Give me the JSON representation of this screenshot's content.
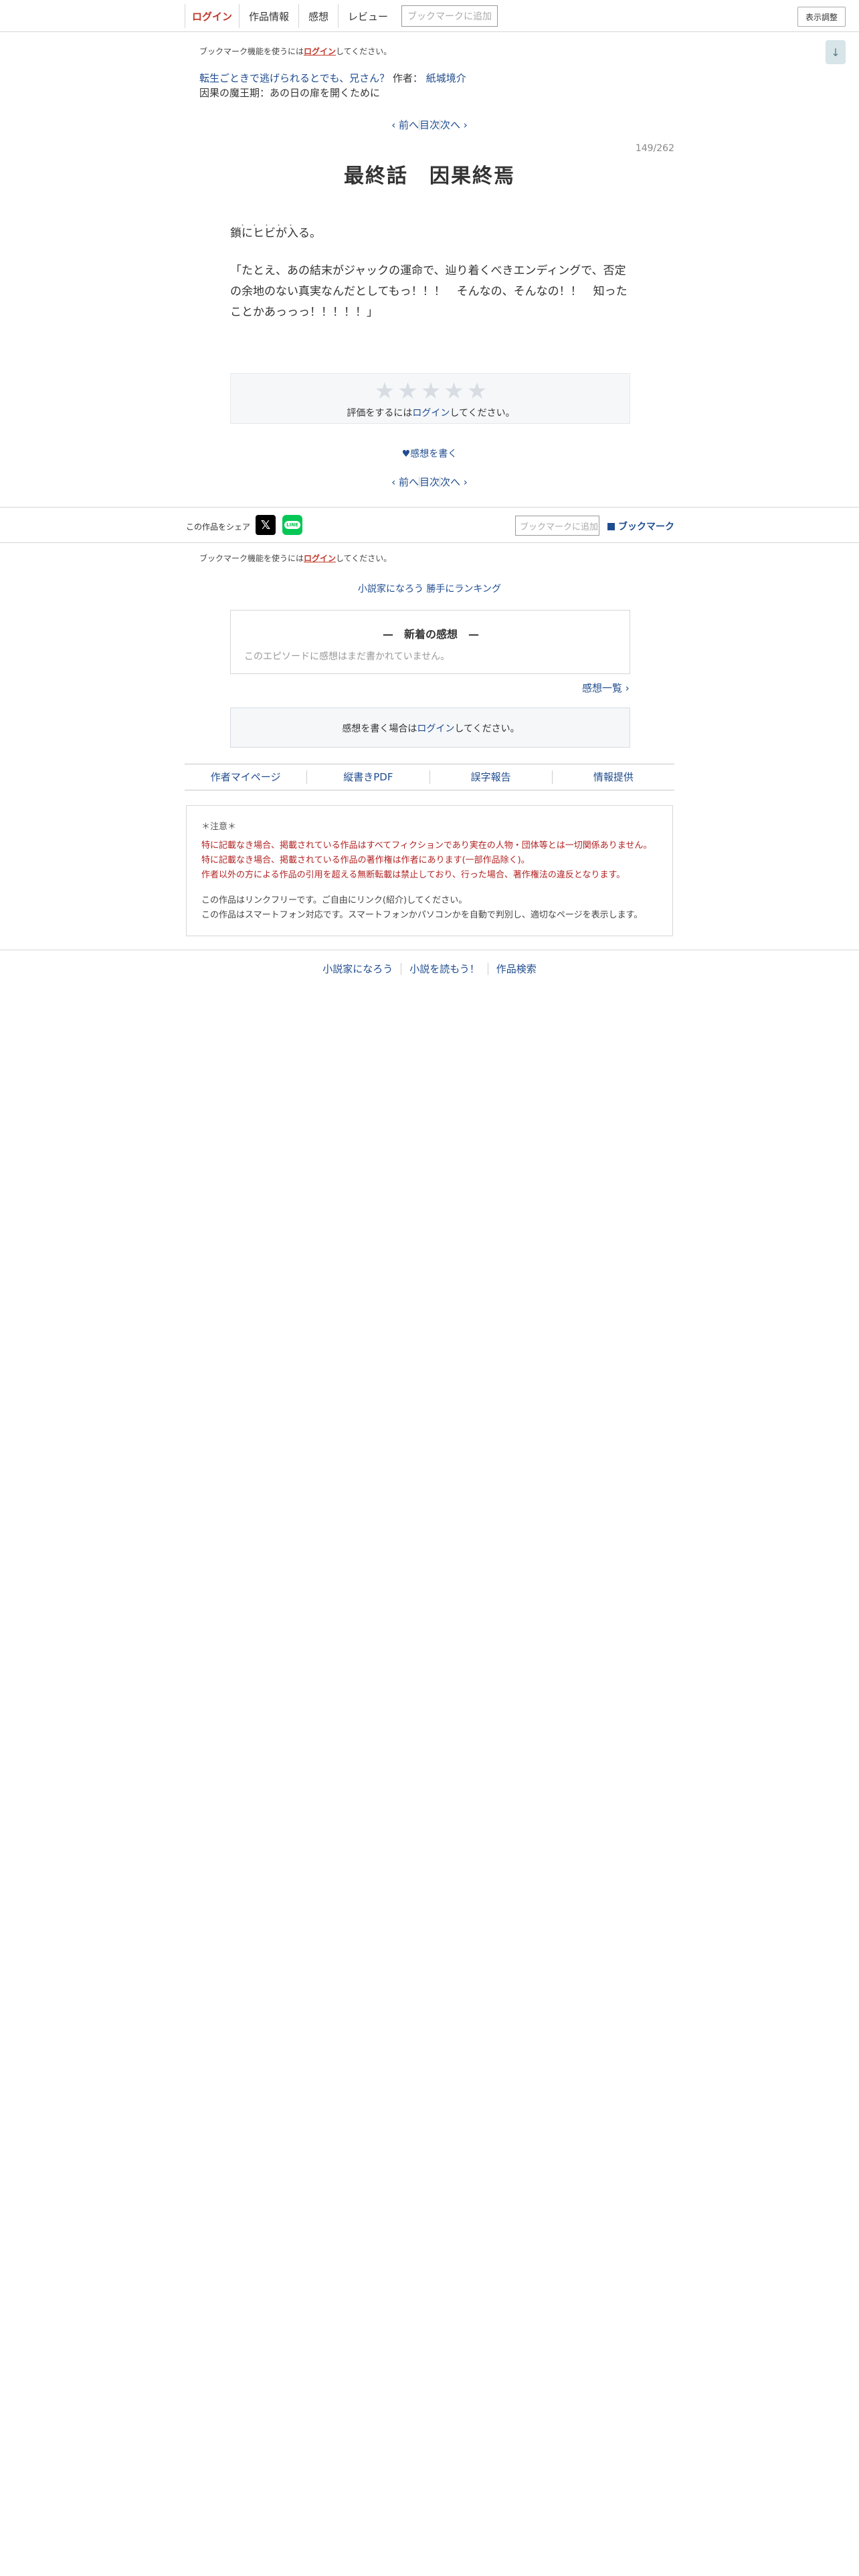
{
  "nav": {
    "login": "ログイン",
    "info": "作品情報",
    "impressions": "感想",
    "review": "レビュー",
    "bookmark_add": "ブックマークに追加",
    "display_settings": "表示調整",
    "scroll_down": "↓"
  },
  "bookmark_notice": {
    "prefix": "ブックマーク機能を使うには",
    "link": "ログイン",
    "suffix": "してください。"
  },
  "novel": {
    "title": "転生ごときで逃げられるとでも、兄さん？",
    "author_label": "作者：",
    "author": "紙城境介",
    "chapter": "因果の魔王期：あの日の扉を開くために"
  },
  "pager": {
    "prev": "‹ 前へ",
    "toc": "目次",
    "next": "次へ ›"
  },
  "episode": {
    "page_number": "149/262",
    "title": "最終話　因果終焉",
    "ruby": "・・・・・",
    "line1": "鎖にヒビが入る。",
    "line2": "「たとえ、あの結末がジャックの運命で、辿り着くべきエンディングで、否定の余地のない真実なんだとしてもっ！！！　そんなの、そんなの！！　知ったことかあっっっ！！！！！」"
  },
  "rating": {
    "stars": [
      "★",
      "★",
      "★",
      "★",
      "★"
    ],
    "prefix": "評価をするには",
    "link": "ログイン",
    "suffix": "してください。"
  },
  "write_impression": "♥感想を書く",
  "share": {
    "label": "この作品をシェア",
    "x": "𝕏",
    "line": "LINE",
    "bookmark_add": "ブックマークに追加",
    "bookmark": "ブックマーク"
  },
  "ranking": "小説家になろう 勝手にランキング",
  "impressions": {
    "title": "—　新着の感想　—",
    "empty": "このエピソードに感想はまだ書かれていません。",
    "list_link": "感想一覧 ›"
  },
  "write_box": {
    "prefix": "感想を書く場合は",
    "link": "ログイン",
    "suffix": "してください。"
  },
  "footer_links": [
    "作者マイページ",
    "縦書きPDF",
    "誤字報告",
    "情報提供"
  ],
  "caution": {
    "head": "＊注意＊",
    "red1": "特に記載なき場合、掲載されている作品はすべてフィクションであり実在の人物・団体等とは一切関係ありません。",
    "red2": "特に記載なき場合、掲載されている作品の著作権は作者にあります(一部作品除く)。",
    "red3": "作者以外の方による作品の引用を超える無断転載は禁止しており、行った場合、著作権法の違反となります。",
    "gray1": "この作品はリンクフリーです。ご自由にリンク(紹介)してください。",
    "gray2": "この作品はスマートフォン対応です。スマートフォンかパソコンかを自動で判別し、適切なページを表示します。"
  },
  "site_footer": [
    "小説家になろう",
    "小説を読もう！",
    "作品検索"
  ]
}
